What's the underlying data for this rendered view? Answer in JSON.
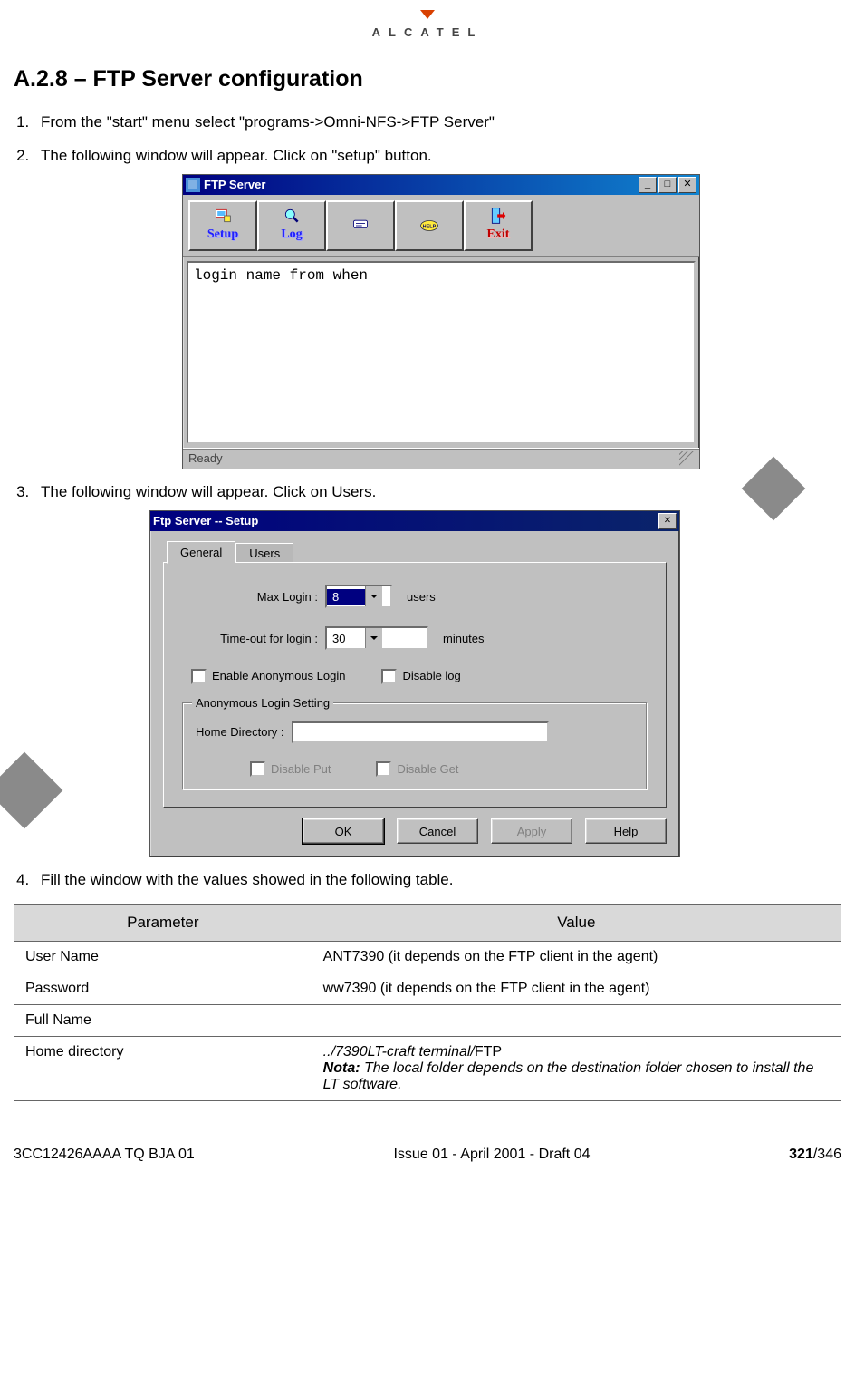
{
  "brand": "ALCATEL",
  "heading": "A.2.8 – FTP Server configuration",
  "steps": {
    "s1": "From the \"start\" menu select \"programs->Omni-NFS->FTP Server\"",
    "s2": "The following window will appear. Click on \"setup\" button.",
    "s3": "The following window will appear. Click on Users.",
    "s4": "Fill the window with the values showed in the following table."
  },
  "win1": {
    "title": "FTP Server",
    "toolbar": {
      "setup": "Setup",
      "log": "Log",
      "exit": "Exit"
    },
    "list_header": "login name  from                when",
    "status": "Ready"
  },
  "win2": {
    "title": "Ftp Server -- Setup",
    "tabs": {
      "general": "General",
      "users": "Users"
    },
    "maxlogin_label": "Max Login :",
    "maxlogin_value": "8",
    "maxlogin_unit": "users",
    "timeout_label": "Time-out for login :",
    "timeout_value": "30",
    "timeout_unit": "minutes",
    "chk_anon": "Enable Anonymous Login",
    "chk_disablelog": "Disable log",
    "group_title": "Anonymous Login Setting",
    "homedir_label": "Home Directory :",
    "chk_disput": "Disable Put",
    "chk_disget": "Disable Get",
    "btn_ok": "OK",
    "btn_cancel": "Cancel",
    "btn_apply": "Apply",
    "btn_help": "Help"
  },
  "table": {
    "head_param": "Parameter",
    "head_value": "Value",
    "rows": [
      {
        "p": "User Name",
        "v": "ANT7390 (it depends on the FTP client in the agent)"
      },
      {
        "p": "Password",
        "v": "ww7390 (it depends on the FTP client in the agent)"
      },
      {
        "p": "Full Name",
        "v": ""
      },
      {
        "p": "Home directory",
        "v_pre_italic": "../7390LT-craft terminal/",
        "v_post": "FTP",
        "note_label": "Nota:",
        "note": " The local folder depends on the destination folder chosen to install the LT software."
      }
    ]
  },
  "footer": {
    "left": "3CC12426AAAA TQ BJA 01",
    "center": "Issue 01 - April 2001 - Draft 04",
    "page_cur": "321",
    "page_tot": "/346"
  }
}
